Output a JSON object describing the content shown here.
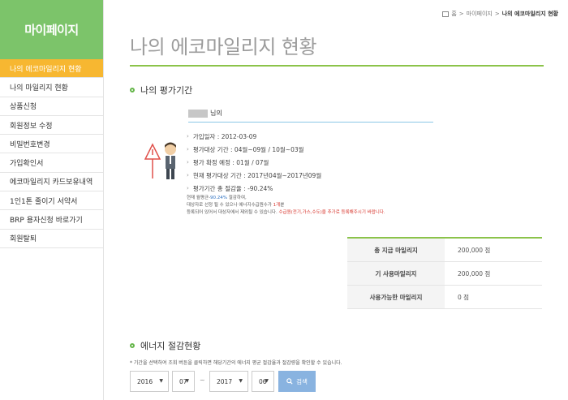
{
  "sidebar": {
    "title": "마이페이지",
    "items": [
      {
        "label": "나의 에코마일리지 현황"
      },
      {
        "label": "나의 마일리지 현황"
      },
      {
        "label": "상품신청"
      },
      {
        "label": "회원정보 수정"
      },
      {
        "label": "비밀번호변경"
      },
      {
        "label": "가입확인서"
      },
      {
        "label": "에코마일리지 카드보유내역"
      },
      {
        "label": "1인1톤 줄이기 서약서"
      },
      {
        "label": "BRP 용자신청 바로가기"
      },
      {
        "label": "회원탈퇴"
      }
    ],
    "active_index": 0,
    "accent": "#7cc46a",
    "active_color": "#f7b731"
  },
  "breadcrumb": {
    "home": "홈",
    "sep1": ">",
    "parent": "마이페이지",
    "sep2": ">",
    "current": "나의 에코마일리지 현황"
  },
  "page": {
    "title": "나의 에코마일리지 현황"
  },
  "evaluation": {
    "section_title": "나의 평가기간",
    "name_suffix": "님의",
    "rows": [
      {
        "text": "가입일자 : 2012-03-09"
      },
      {
        "text": "평가대상 기간 : 04월~09월 / 10월~03월"
      },
      {
        "text": "평가 확정 예정 : 01월 / 07월"
      },
      {
        "text": "현재 평가대상 기간 : 2017년04월~2017년09월"
      },
      {
        "text": "평가기간 총 절감율 : -90.24%"
      }
    ],
    "note1_pre": "현재 월평균-",
    "note1_val": "90.24%",
    "note1_post": " 절감하여,",
    "note2_pre": "대상자로 선정 될 수 있으나 에너지수급원수가 ",
    "note2_val": "1개",
    "note2_post": "뿐",
    "note3_pre": "등록되어 있어서 대상자에서 제외될 수 있습니다. ",
    "note3_red": "수급원(전기,가스,수도)을 추가로 등록해주시기 바랍니다."
  },
  "mileage": {
    "rows": [
      {
        "label": "총 지급 마일리지",
        "value": "200,000 점"
      },
      {
        "label": "기 사용마일리지",
        "value": "200,000 점"
      },
      {
        "label": "사용가능한 마일리지",
        "value": "0 점"
      }
    ]
  },
  "energy": {
    "section_title": "에너지 절감현황",
    "description": "* 기간을 선택하여 조회 버튼을 클릭하면 해당기간의 에너지 평균 절감율과 절감량을 확인할 수 있습니다.",
    "start_year": "2016",
    "start_month": "07",
    "tilde": "~",
    "end_year": "2017",
    "end_month": "06",
    "search_label": "검색",
    "button_color": "#89b3e0"
  }
}
